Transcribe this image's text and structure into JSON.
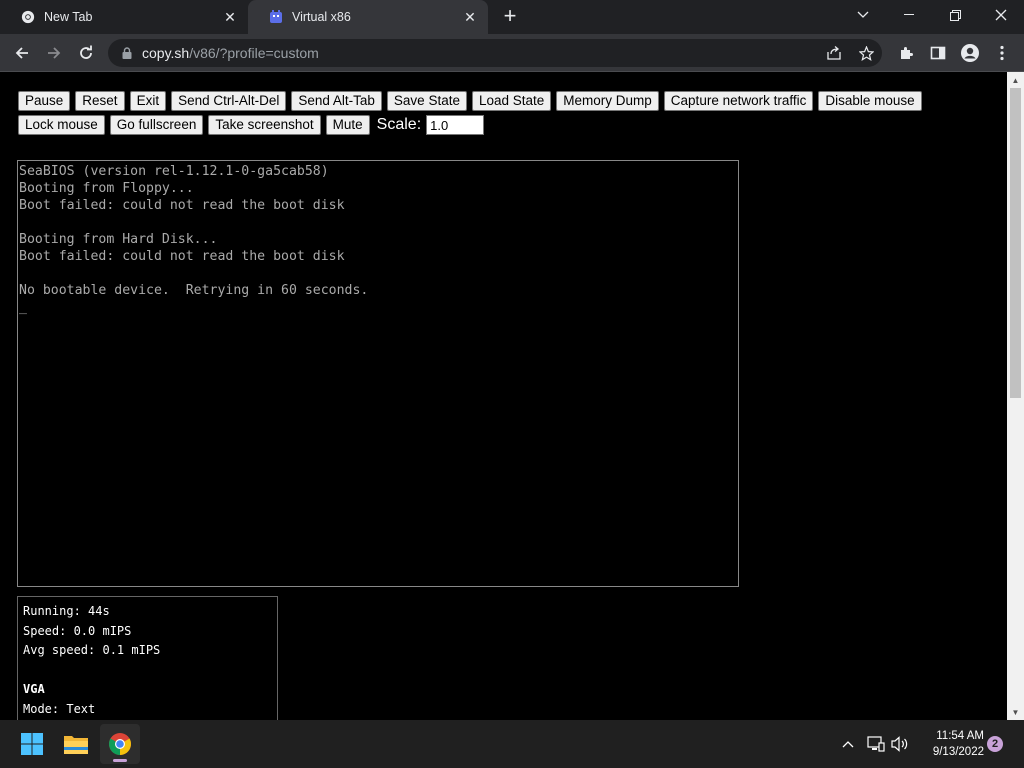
{
  "browser": {
    "tabs": [
      {
        "title": "New Tab",
        "icon": "chrome-icon",
        "active": false
      },
      {
        "title": "Virtual x86",
        "icon": "v86-icon",
        "active": true
      }
    ],
    "new_tab_symbol": "+",
    "close_symbol": "✕",
    "url_host": "copy.sh",
    "url_rest": "/v86/?profile=custom",
    "window_controls": {
      "dropdown": "⌄",
      "minimize": "—",
      "restore": "❐",
      "close": "✕"
    }
  },
  "controls": {
    "row1": [
      "Pause",
      "Reset",
      "Exit",
      "Send Ctrl-Alt-Del",
      "Send Alt-Tab",
      "Save State",
      "Load State",
      "Memory Dump",
      "Capture network traffic",
      "Disable mouse"
    ],
    "row2": [
      "Lock mouse",
      "Go fullscreen",
      "Take screenshot",
      "Mute"
    ],
    "scale_label": "Scale:",
    "scale_value": "1.0"
  },
  "screen": {
    "lines": [
      "SeaBIOS (version rel-1.12.1-0-ga5cab58)",
      "Booting from Floppy...",
      "Boot failed: could not read the boot disk",
      "",
      "Booting from Hard Disk...",
      "Boot failed: could not read the boot disk",
      "",
      "No bootable device.  Retrying in 60 seconds.",
      "_"
    ]
  },
  "info": {
    "lines": [
      {
        "text": "Running: 44s",
        "bold": false
      },
      {
        "text": "Speed: 0.0 mIPS",
        "bold": false
      },
      {
        "text": "Avg speed: 0.1 mIPS",
        "bold": false
      },
      {
        "text": "",
        "bold": false
      },
      {
        "text": "VGA",
        "bold": true
      },
      {
        "text": "Mode: Text",
        "bold": false
      }
    ]
  },
  "taskbar": {
    "apps": [
      "windows-start-icon",
      "file-explorer-icon",
      "chrome-icon"
    ],
    "time": "11:54 AM",
    "date": "9/13/2022",
    "notification_count": "2"
  },
  "colors": {
    "tab_bar": "#202124",
    "toolbar": "#35363a",
    "page_bg": "#000000",
    "terminal_text": "#aaaaaa",
    "taskbar": "#202020",
    "accent": "#c8a2d8"
  }
}
